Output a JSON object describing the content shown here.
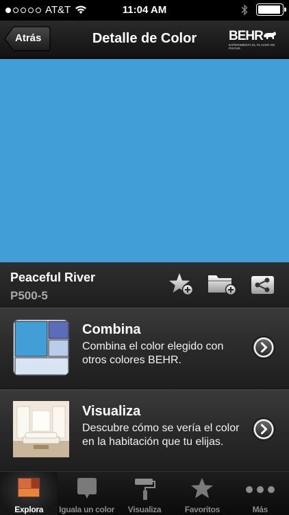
{
  "status_bar": {
    "carrier": "AT&T",
    "time": "11:04 AM",
    "signal_bars": 1,
    "battery_level": 0.95
  },
  "nav": {
    "back_label": "Atrás",
    "title": "Detalle de Color",
    "brand": "BEHR",
    "brand_tagline": "EXPERIMENTA EL PLACER DE PINTAR."
  },
  "color": {
    "name": "Peaceful River",
    "code": "P500-5",
    "hex": "#419ed6"
  },
  "actions": {
    "favorite_icon": "star-plus-icon",
    "folder_icon": "folder-plus-icon",
    "share_icon": "share-icon"
  },
  "cards": [
    {
      "title": "Combina",
      "description": "Combina el color elegido con otros colores BEHR.",
      "icon": "color-palette-icon"
    },
    {
      "title": "Visualiza",
      "description": "Descubre cómo se vería el color en la habitación que tu elijas.",
      "icon": "room-preview-icon"
    }
  ],
  "tabs": [
    {
      "label": "Explora",
      "icon": "explore-icon",
      "active": true
    },
    {
      "label": "Iguala un color",
      "icon": "match-color-icon",
      "active": false
    },
    {
      "label": "Visualiza",
      "icon": "paint-roller-icon",
      "active": false
    },
    {
      "label": "Favoritos",
      "icon": "star-icon",
      "active": false
    },
    {
      "label": "Más",
      "icon": "more-icon",
      "active": false
    }
  ],
  "colors": {
    "swatch": "#419ed6",
    "palette_dark_blue": "#5b6cbb",
    "palette_light_blue": "#b9cdeb",
    "palette_pale_blue": "#d8e4f3",
    "explore_orange": "#c0532b"
  }
}
